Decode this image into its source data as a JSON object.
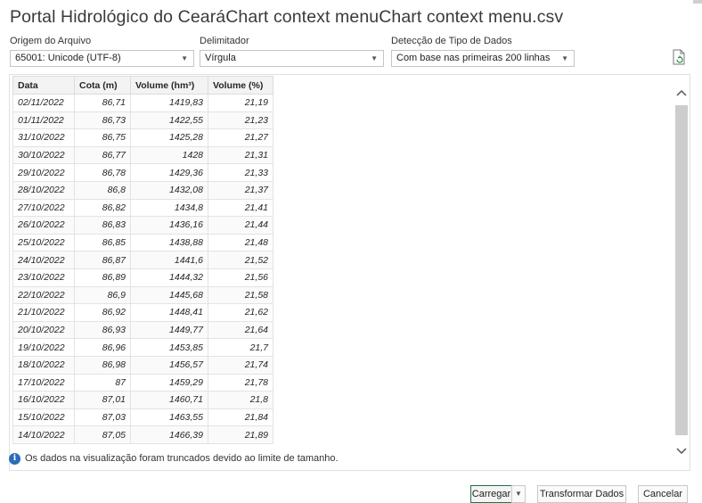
{
  "window": {
    "title": "Portal Hidrológico do CearáChart context menuChart context menu.csv"
  },
  "options": {
    "origem": {
      "label": "Origem do Arquivo",
      "value": "65001: Unicode (UTF-8)"
    },
    "delimitador": {
      "label": "Delimitador",
      "value": "Vírgula"
    },
    "deteccao": {
      "label": "Detecção de Tipo de Dados",
      "value": "Com base nas primeiras 200 linhas"
    }
  },
  "table": {
    "columns": [
      "Data",
      "Cota (m)",
      "Volume (hm³)",
      "Volume (%)"
    ],
    "rows": [
      [
        "02/11/2022",
        "86,71",
        "1419,83",
        "21,19"
      ],
      [
        "01/11/2022",
        "86,73",
        "1422,55",
        "21,23"
      ],
      [
        "31/10/2022",
        "86,75",
        "1425,28",
        "21,27"
      ],
      [
        "30/10/2022",
        "86,77",
        "1428",
        "21,31"
      ],
      [
        "29/10/2022",
        "86,78",
        "1429,36",
        "21,33"
      ],
      [
        "28/10/2022",
        "86,8",
        "1432,08",
        "21,37"
      ],
      [
        "27/10/2022",
        "86,82",
        "1434,8",
        "21,41"
      ],
      [
        "26/10/2022",
        "86,83",
        "1436,16",
        "21,44"
      ],
      [
        "25/10/2022",
        "86,85",
        "1438,88",
        "21,48"
      ],
      [
        "24/10/2022",
        "86,87",
        "1441,6",
        "21,52"
      ],
      [
        "23/10/2022",
        "86,89",
        "1444,32",
        "21,56"
      ],
      [
        "22/10/2022",
        "86,9",
        "1445,68",
        "21,58"
      ],
      [
        "21/10/2022",
        "86,92",
        "1448,41",
        "21,62"
      ],
      [
        "20/10/2022",
        "86,93",
        "1449,77",
        "21,64"
      ],
      [
        "19/10/2022",
        "86,96",
        "1453,85",
        "21,7"
      ],
      [
        "18/10/2022",
        "86,98",
        "1456,57",
        "21,74"
      ],
      [
        "17/10/2022",
        "87",
        "1459,29",
        "21,78"
      ],
      [
        "16/10/2022",
        "87,01",
        "1460,71",
        "21,8"
      ],
      [
        "15/10/2022",
        "87,03",
        "1463,55",
        "21,84"
      ],
      [
        "14/10/2022",
        "87,05",
        "1466,39",
        "21,89"
      ]
    ]
  },
  "info": {
    "message": "Os dados na visualização foram truncados devido ao limite de tamanho."
  },
  "buttons": {
    "carregar": "Carregar",
    "transformar": "Transformar Dados",
    "cancelar": "Cancelar"
  },
  "icons": {
    "info": "info-icon",
    "file": "file-refresh-icon",
    "scroll_up": "chevron-up-icon",
    "scroll_down": "chevron-down-icon",
    "dropdown": "chevron-down-icon"
  },
  "colors": {
    "info_blue": "#2b6cb8",
    "primary_border": "#217346"
  }
}
